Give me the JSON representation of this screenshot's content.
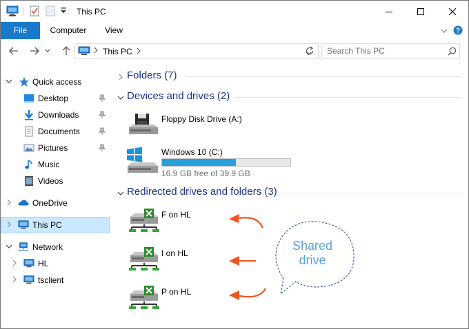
{
  "window": {
    "title": "This PC",
    "controls": {
      "minimize": "minimize-icon",
      "maximize": "maximize-icon",
      "close": "close-icon"
    }
  },
  "ribbon": {
    "tabs": [
      {
        "label": "File"
      },
      {
        "label": "Computer"
      },
      {
        "label": "View"
      }
    ]
  },
  "nav": {
    "address_location": "This PC",
    "search_placeholder": "Search This PC"
  },
  "sidebar": {
    "quick_access": "Quick access",
    "quick_items": [
      {
        "label": "Desktop",
        "icon": "desktop-icon"
      },
      {
        "label": "Downloads",
        "icon": "downloads-icon"
      },
      {
        "label": "Documents",
        "icon": "documents-icon"
      },
      {
        "label": "Pictures",
        "icon": "pictures-icon"
      },
      {
        "label": "Music",
        "icon": "music-icon"
      },
      {
        "label": "Videos",
        "icon": "videos-icon"
      }
    ],
    "onedrive": "OneDrive",
    "thispc": "This PC",
    "network": "Network",
    "network_items": [
      {
        "label": "HL"
      },
      {
        "label": "tsclient"
      }
    ]
  },
  "main": {
    "folders_group": "Folders (7)",
    "devices_group": "Devices and drives (2)",
    "devices": [
      {
        "label": "Floppy Disk Drive (A:)"
      },
      {
        "label": "Windows 10 (C:)",
        "free_text": "16.9 GB free of 39.9 GB",
        "used_fraction": 0.576
      }
    ],
    "redirected_group": "Redirected drives and folders (3)",
    "redirected": [
      {
        "label": "F on HL"
      },
      {
        "label": "I on HL"
      },
      {
        "label": "P on HL"
      }
    ]
  },
  "annotation": {
    "callout_line1": "Shared",
    "callout_line2": "drive",
    "arrow_color": "#f0541e",
    "callout_text_color": "#5aa0d8"
  },
  "colors": {
    "accent": "#1979ca",
    "selection": "#cce8ff",
    "group_heading": "#1e3287",
    "progress": "#26a0da"
  }
}
